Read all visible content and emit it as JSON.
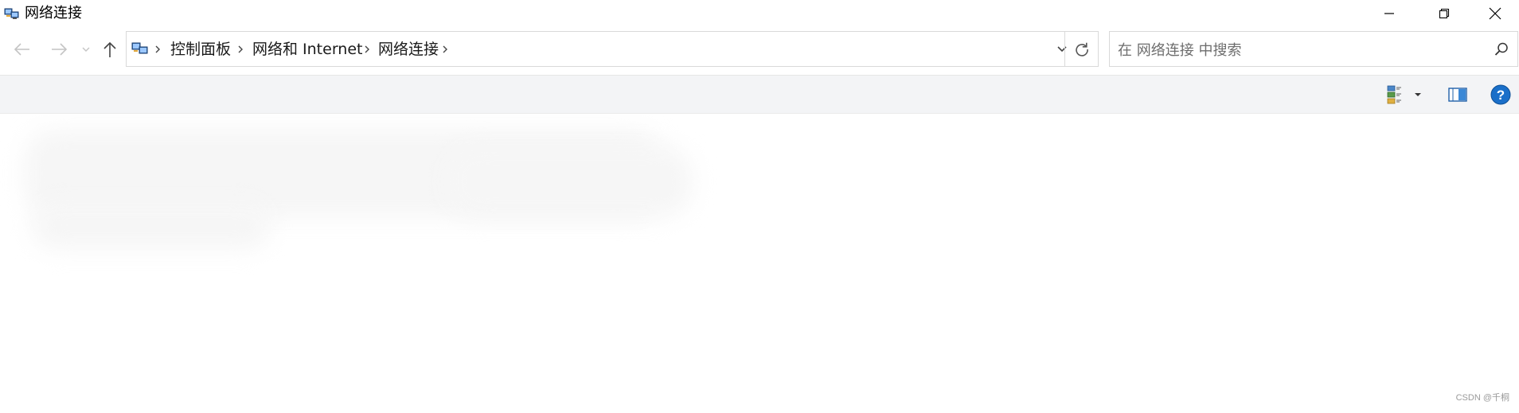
{
  "window": {
    "title": "网络连接"
  },
  "navigation": {
    "back_icon": "arrow-left-icon",
    "forward_icon": "arrow-right-icon",
    "recent_icon": "chevron-down-icon",
    "up_icon": "arrow-up-icon"
  },
  "address_bar": {
    "breadcrumbs": [
      "控制面板",
      "网络和 Internet",
      "网络连接"
    ]
  },
  "search": {
    "placeholder": "在 网络连接 中搜索"
  },
  "command_bar": {
    "view_icon": "change-view-icon",
    "preview_icon": "preview-pane-icon",
    "help_icon": "help-icon",
    "help_label": "?"
  },
  "watermark": {
    "text": "CSDN @千桐"
  },
  "colors": {
    "command_bar_bg": "#f3f4f6",
    "help_blue": "#1a6fc9",
    "border": "#d9d9d9"
  }
}
